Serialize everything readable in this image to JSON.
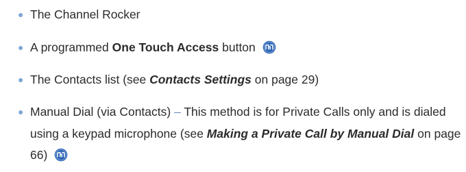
{
  "items": [
    {
      "text": "The Channel Rocker"
    },
    {
      "prefix": "A programmed ",
      "bold": "One Touch Access",
      "suffix": " button",
      "icon": "one-touch-access-icon"
    },
    {
      "prefix": "The Contacts list (see ",
      "link": "Contacts Settings",
      "suffix": " on page 29)"
    },
    {
      "prefix": "Manual Dial (via Contacts) ",
      "dash": "–",
      "middle": " This method is for Private Calls only and is dialed using a keypad microphone (see ",
      "link": "Making a Private Call by Manual Dial",
      "suffix": " on page 66)",
      "icon": "one-touch-access-icon"
    }
  ],
  "colors": {
    "bullet": "#7fa7d4",
    "icon_fill": "#2f66b5",
    "text": "#2b2b2b"
  }
}
